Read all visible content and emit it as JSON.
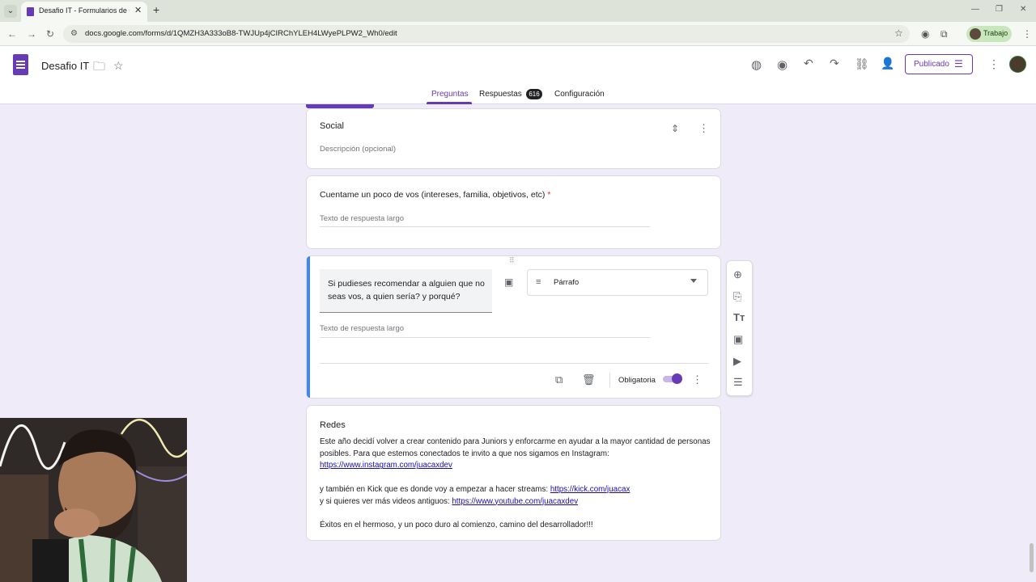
{
  "browser": {
    "tab_title": "Desafio IT - Formularios de Goo",
    "url": "docs.google.com/forms/d/1QMZH3A333oB8-TWJUp4jCIRChYLEH4LWyePLPW2_Wh0/edit",
    "profile_label": "Trabajo"
  },
  "header": {
    "title": "Desafio IT",
    "publish_label": "Publicado"
  },
  "tabs": {
    "questions": "Preguntas",
    "responses": "Respuestas",
    "responses_count": "616",
    "settings": "Configuración"
  },
  "section": {
    "title": "Social",
    "description_placeholder": "Descripción (opcional)"
  },
  "question1": {
    "title": "Cuentame un poco de vos (intereses, familia, objetivos, etc)",
    "required_mark": "*",
    "answer_placeholder": "Texto de respuesta largo"
  },
  "question2": {
    "title": "Si pudieses recomendar a alguien que no seas vos, a quien sería? y porqué?",
    "type": "Párrafo",
    "answer_placeholder": "Texto de respuesta largo",
    "required_label": "Obligatoria",
    "required": true
  },
  "redes": {
    "title": "Redes",
    "line1": "Este año decidí volver a crear contenido para Juniors y enforcarme en ayudar a la mayor cantidad de personas posibles. Para que estemos conectados te invito a que nos sigamos en Instagram:",
    "instagram_link": "https://www.instagram.com/juacaxdev",
    "line2": "y también en Kick que es donde voy a empezar a hacer streams: ",
    "kick_link": "https://kick.com/juacax",
    "line3": "y si quieres ver más videos antiguos: ",
    "youtube_link": "https://www.youtube.com/juacaxdev",
    "line4": "Éxitos en el hermoso, y un poco duro al comienzo, camino del desarrollador!!!"
  },
  "colors": {
    "accent": "#673ab7",
    "background": "#f0ebf8",
    "active_question_bar": "#4285f4"
  }
}
